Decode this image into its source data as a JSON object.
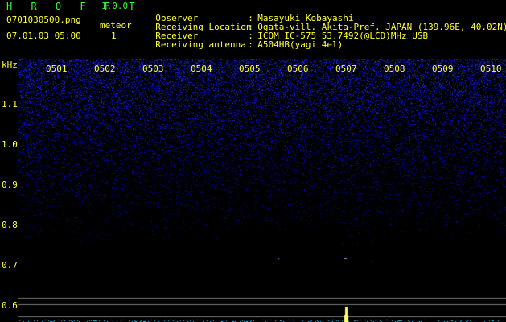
{
  "header": {
    "app_title": "H R O F F T",
    "app_version": "1.0.0",
    "filename": "0701030500.png",
    "datetime": "07.01.03 05:00",
    "meteor_label": "meteor",
    "meteor_count": "1"
  },
  "info": [
    {
      "key": "Observer",
      "value": "Masayuki Kobayashi"
    },
    {
      "key": "Receiving Location",
      "value": "Ogata-vill. Akita-Pref. JAPAN (139.96E, 40.02N)"
    },
    {
      "key": "Receiver",
      "value": "ICOM IC-575 53.7492(@LCD)MHz USB"
    },
    {
      "key": "Receiving antenna",
      "value": "A504HB(yagi 4el)"
    }
  ],
  "separator": ":",
  "axis": {
    "y_unit": "kHz",
    "y_ticks": [
      "1.1",
      "1.0",
      "0.9",
      "0.8",
      "0.7",
      "0.6"
    ],
    "x_ticks": [
      "0501",
      "0502",
      "0503",
      "0504",
      "0505",
      "0506",
      "0507",
      "0508",
      "0509",
      "0510"
    ]
  },
  "colors": {
    "background": "#000000",
    "text": "#ffff33",
    "title": "#33ff33",
    "noise": "#2a3cff",
    "gridline": "#7a7a7a",
    "echo": "#ffff66",
    "baseline": "#33ccff"
  }
}
